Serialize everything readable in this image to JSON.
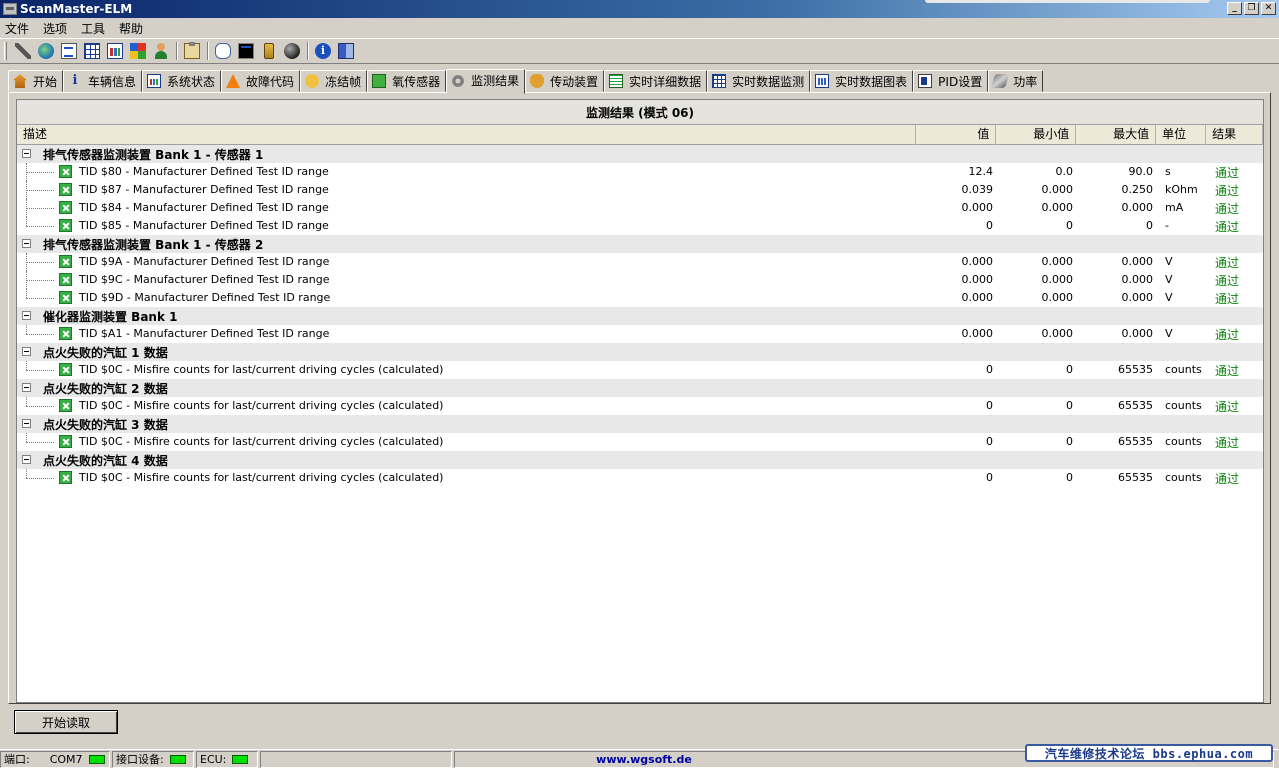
{
  "window": {
    "title": "ScanMaster-ELM"
  },
  "menu": [
    "文件",
    "选项",
    "工具",
    "帮助"
  ],
  "toolbar_icons": [
    "wrench-icon",
    "globe-icon",
    "document-icon",
    "grid-icon",
    "bar-chart-icon",
    "windows-logo-icon",
    "person-icon",
    "clipboard-icon",
    "chat-icon",
    "terminal-icon",
    "battery-icon",
    "ball-icon",
    "info-icon",
    "exit-door-icon"
  ],
  "tabs": [
    {
      "label": "开始",
      "icon": "home-icon"
    },
    {
      "label": "车辆信息",
      "icon": "info-icon"
    },
    {
      "label": "系统状态",
      "icon": "status-chart-icon"
    },
    {
      "label": "故障代码",
      "icon": "warning-icon"
    },
    {
      "label": "冻结帧",
      "icon": "hand-icon"
    },
    {
      "label": "氧传感器",
      "icon": "sensor-icon"
    },
    {
      "label": "监测结果",
      "icon": "gear-icon",
      "active": true
    },
    {
      "label": "传动装置",
      "icon": "hand-icon"
    },
    {
      "label": "实时详细数据",
      "icon": "table-icon"
    },
    {
      "label": "实时数据监测",
      "icon": "grid-icon"
    },
    {
      "label": "实时数据图表",
      "icon": "chart-icon"
    },
    {
      "label": "PID设置",
      "icon": "pid-icon"
    },
    {
      "label": "功率",
      "icon": "power-icon"
    }
  ],
  "results": {
    "title": "监测结果 (模式 06)",
    "columns": {
      "desc": "描述",
      "value": "值",
      "min": "最小值",
      "max": "最大值",
      "unit": "单位",
      "result": "结果"
    },
    "groups": [
      {
        "name": "排气传感器监测装置 Bank 1 - 传感器 1",
        "items": [
          {
            "desc": "TID $80 - Manufacturer Defined Test ID range",
            "value": "12.4",
            "min": "0.0",
            "max": "90.0",
            "unit": "s",
            "result": "通过"
          },
          {
            "desc": "TID $87 - Manufacturer Defined Test ID range",
            "value": "0.039",
            "min": "0.000",
            "max": "0.250",
            "unit": "kOhm",
            "result": "通过"
          },
          {
            "desc": "TID $84 - Manufacturer Defined Test ID range",
            "value": "0.000",
            "min": "0.000",
            "max": "0.000",
            "unit": "mA",
            "result": "通过"
          },
          {
            "desc": "TID $85 - Manufacturer Defined Test ID range",
            "value": "0",
            "min": "0",
            "max": "0",
            "unit": "-",
            "result": "通过"
          }
        ]
      },
      {
        "name": "排气传感器监测装置 Bank 1 - 传感器 2",
        "items": [
          {
            "desc": "TID $9A - Manufacturer Defined Test ID range",
            "value": "0.000",
            "min": "0.000",
            "max": "0.000",
            "unit": "V",
            "result": "通过"
          },
          {
            "desc": "TID $9C - Manufacturer Defined Test ID range",
            "value": "0.000",
            "min": "0.000",
            "max": "0.000",
            "unit": "V",
            "result": "通过"
          },
          {
            "desc": "TID $9D - Manufacturer Defined Test ID range",
            "value": "0.000",
            "min": "0.000",
            "max": "0.000",
            "unit": "V",
            "result": "通过"
          }
        ]
      },
      {
        "name": "催化器监测装置 Bank 1",
        "items": [
          {
            "desc": "TID $A1 - Manufacturer Defined Test ID range",
            "value": "0.000",
            "min": "0.000",
            "max": "0.000",
            "unit": "V",
            "result": "通过"
          }
        ]
      },
      {
        "name": "点火失败的汽缸 1 数据",
        "items": [
          {
            "desc": "TID $0C - Misfire counts for last/current driving cycles (calculated)",
            "value": "0",
            "min": "0",
            "max": "65535",
            "unit": "counts",
            "result": "通过"
          }
        ]
      },
      {
        "name": "点火失败的汽缸 2 数据",
        "items": [
          {
            "desc": "TID $0C - Misfire counts for last/current driving cycles (calculated)",
            "value": "0",
            "min": "0",
            "max": "65535",
            "unit": "counts",
            "result": "通过"
          }
        ]
      },
      {
        "name": "点火失败的汽缸 3 数据",
        "items": [
          {
            "desc": "TID $0C - Misfire counts for last/current driving cycles (calculated)",
            "value": "0",
            "min": "0",
            "max": "65535",
            "unit": "counts",
            "result": "通过"
          }
        ]
      },
      {
        "name": "点火失败的汽缸 4 数据",
        "items": [
          {
            "desc": "TID $0C - Misfire counts for last/current driving cycles (calculated)",
            "value": "0",
            "min": "0",
            "max": "65535",
            "unit": "counts",
            "result": "通过"
          }
        ]
      }
    ]
  },
  "start_button": "开始读取",
  "status": {
    "port_label": "端口:",
    "port_value": "COM7",
    "device_label": "接口设备:",
    "ecu_label": "ECU:",
    "url": "www.wgsoft.de",
    "led_color": "#00e000"
  },
  "watermark": "汽车维修技术论坛 bbs.ephua.com",
  "colors": {
    "titlebar": "#0a246a",
    "pass": "#108010",
    "face": "#d4d0c8"
  }
}
